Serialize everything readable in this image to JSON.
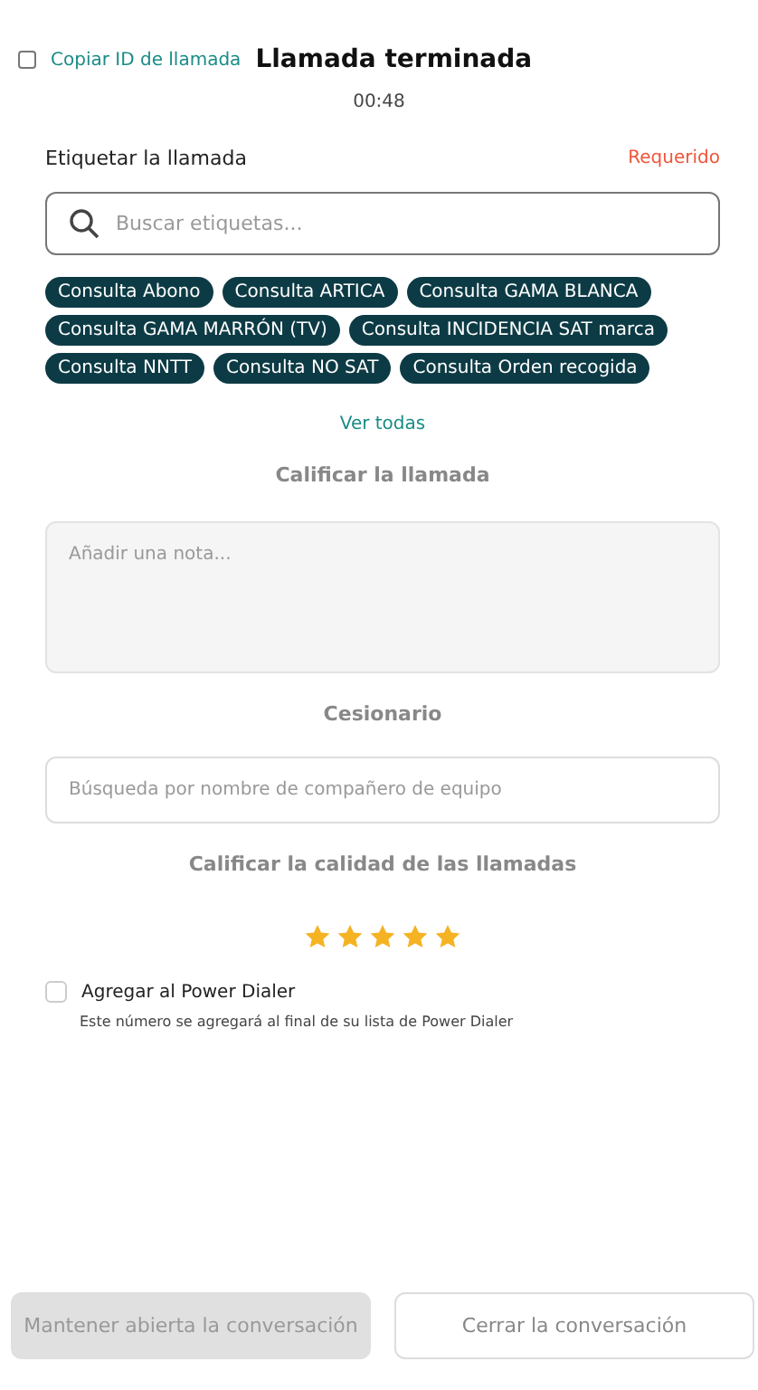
{
  "header": {
    "copy_id": {
      "label": "Copiar ID de llamada",
      "checked": false
    },
    "title": "Llamada terminada",
    "timer": "00:48"
  },
  "tagging": {
    "label": "Etiquetar la llamada",
    "required": "Requerido",
    "search": {
      "placeholder": "Buscar etiquetas..."
    },
    "tags": [
      "Consulta Abono",
      "Consulta ARTICA",
      "Consulta GAMA BLANCA",
      "Consulta GAMA MARRÓN (TV)",
      "Consulta INCIDENCIA SAT marca",
      "Consulta NNTT",
      "Consulta NO SAT",
      "Consulta Orden recogida"
    ],
    "see_all": "Ver todas"
  },
  "rating": {
    "label": "Calificar la llamada",
    "note": {
      "placeholder": "Añadir una nota..."
    }
  },
  "assignee": {
    "label": "Cesionario",
    "search": {
      "placeholder": "Búsqueda por nombre de compañero de equipo"
    }
  },
  "quality": {
    "label": "Calificar la calidad de las llamadas",
    "stars": 5
  },
  "power_dialer": {
    "label": "Agregar al Power Dialer",
    "checked": false,
    "hint": "Este número se agregará al final de su lista de Power Dialer"
  },
  "buttons": [
    {
      "label": "Mantener abierta la conversación",
      "disabled": true
    },
    {
      "label": "Cerrar la conversación",
      "disabled": false
    }
  ]
}
